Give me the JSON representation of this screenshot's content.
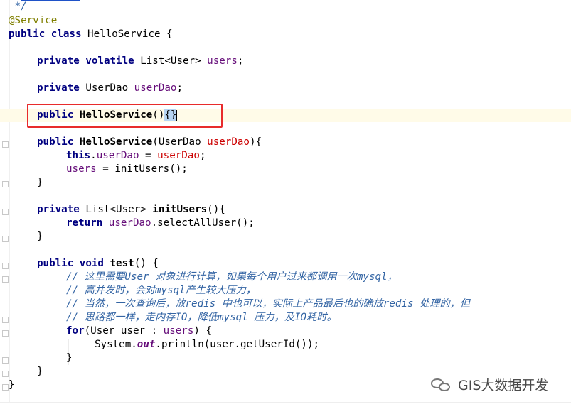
{
  "editor": {
    "comment_close": " */",
    "annotation": "@Service",
    "class_decl": {
      "kw": "public class",
      "name": " HelloService",
      "brace": " {"
    },
    "field_users": {
      "kw": "private volatile",
      "type": " List<User> ",
      "name": "users",
      "semi": ";"
    },
    "field_dao": {
      "kw": "private",
      "type": " UserDao ",
      "name": "userDao",
      "semi": ";"
    },
    "ctor_empty": {
      "kw": "public",
      "name": " HelloService",
      "paren": "()",
      "body": "{}"
    },
    "ctor_dao": {
      "kw": "public",
      "name": " HelloService",
      "open": "(UserDao ",
      "param": "userDao",
      "close": "){"
    },
    "ctor_body1": {
      "kw": "this",
      "dot": ".",
      "field": "userDao",
      "eq": " = ",
      "param": "userDao",
      "semi": ";"
    },
    "ctor_body2": {
      "field": "users",
      "rest": " = initUsers();"
    },
    "close_brace": "}",
    "method_init": {
      "kw": "private",
      "type": " List<User> ",
      "name": "initUsers",
      "rest": "(){"
    },
    "method_init_body": {
      "kw": "return",
      "sp": " ",
      "field": "userDao",
      "rest": ".selectAllUser();"
    },
    "method_test": {
      "kw": "public void",
      "name": " test",
      "rest": "() {"
    },
    "comments": [
      {
        "pre": "// 这里需要",
        "code": "User",
        "post": " 对象进行计算，如果每个用户过来都调用一次",
        "code2": "mysql",
        "post2": "，"
      },
      {
        "pre": "// 高并发时，会对",
        "code": "mysql",
        "post": "产生较大压力，",
        "code2": "",
        "post2": ""
      },
      {
        "pre": "// 当然，一次查询后，放",
        "code": "redis",
        "post": " 中也可以，实际上产品最后也的确放",
        "code2": "redis",
        "post2": " 处理的，但"
      },
      {
        "pre": "// 思路都一样，走内存",
        "code": "IO",
        "post": "，降低",
        "code2": "mysql",
        "post2": " 压力，及IO耗时。"
      }
    ],
    "for_loop": {
      "kw": "for",
      "rest": "(User user : ",
      "field": "users",
      "tail": ") {"
    },
    "println": {
      "cls": "System.",
      "out": "out",
      "rest": ".println(user.getUserId());"
    }
  },
  "watermark": {
    "text": "GIS大数据开发",
    "icon": "wechat-icon"
  },
  "colors": {
    "highlight_border": "#e82b2b",
    "selection": "#b6d4f3",
    "current_line": "#fffbe8"
  }
}
